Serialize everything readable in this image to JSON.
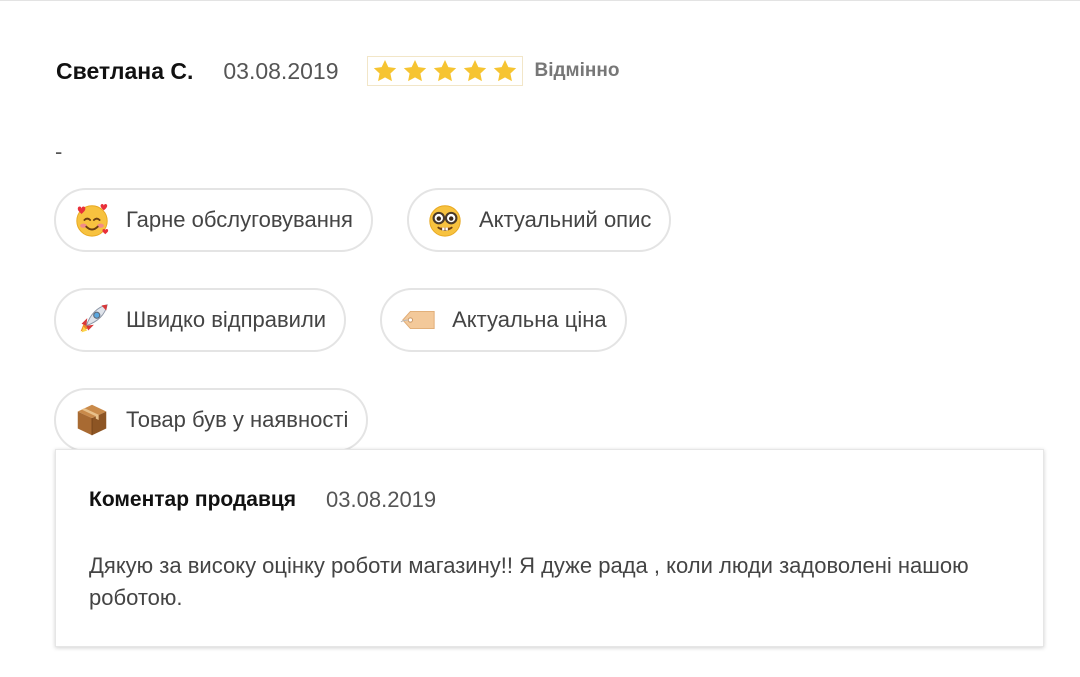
{
  "review": {
    "author": "Светлана С.",
    "date": "03.08.2019",
    "rating": 5,
    "rating_max": 5,
    "rating_label": "Відмінно",
    "star_color": "#f6c431",
    "text": "-"
  },
  "tags": [
    {
      "emoji": "smiling-face-with-hearts-icon",
      "label": "Гарне обслуговування"
    },
    {
      "emoji": "nerd-face-icon",
      "label": "Актуальний опис"
    },
    {
      "emoji": "rocket-icon",
      "label": "Швидко відправили"
    },
    {
      "emoji": "price-tag-icon",
      "label": "Актуальна ціна"
    },
    {
      "emoji": "package-icon",
      "label": "Товар був у наявності"
    }
  ],
  "seller_comment": {
    "title": "Коментар продавця",
    "date": "03.08.2019",
    "text": "Дякую за високу оцінку роботи магазину!! Я дуже рада , коли люди задоволені нашою роботою."
  }
}
